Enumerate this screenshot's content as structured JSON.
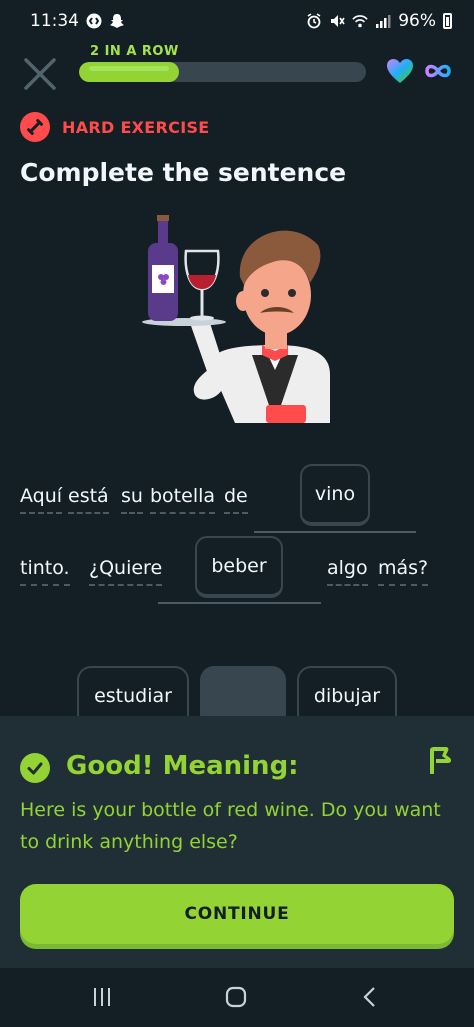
{
  "status_bar": {
    "time": "11:34",
    "battery": "96%"
  },
  "header": {
    "streak_label": "2 IN A ROW",
    "progress": 0.35
  },
  "exercise": {
    "difficulty_label": "HARD EXERCISE",
    "title": "Complete the sentence",
    "sentence": {
      "line1_words": [
        "Aquí",
        "está",
        "su",
        "botella",
        "de"
      ],
      "blank1": "vino",
      "line2_words": [
        "tinto.",
        "¿Quiere"
      ],
      "blank2": "beber",
      "line2_after": [
        "algo",
        "más?"
      ]
    },
    "word_bank": [
      "estudiar",
      "",
      "dibujar"
    ]
  },
  "feedback": {
    "title": "Good! Meaning:",
    "text": "Here is your bottle of red wine. Do you want to drink anything else?",
    "continue_label": "CONTINUE"
  },
  "colors": {
    "background": "#131f24",
    "accent_green": "#93d333",
    "hard_red": "#ff4b4b",
    "chip_border": "#37464f",
    "feedback_bg": "#202f36"
  },
  "icons": {
    "close": "close-icon",
    "heart": "heart-icon",
    "infinity": "infinity-icon",
    "hard": "dumbbell-icon",
    "check": "check-icon",
    "report": "flag-icon"
  }
}
